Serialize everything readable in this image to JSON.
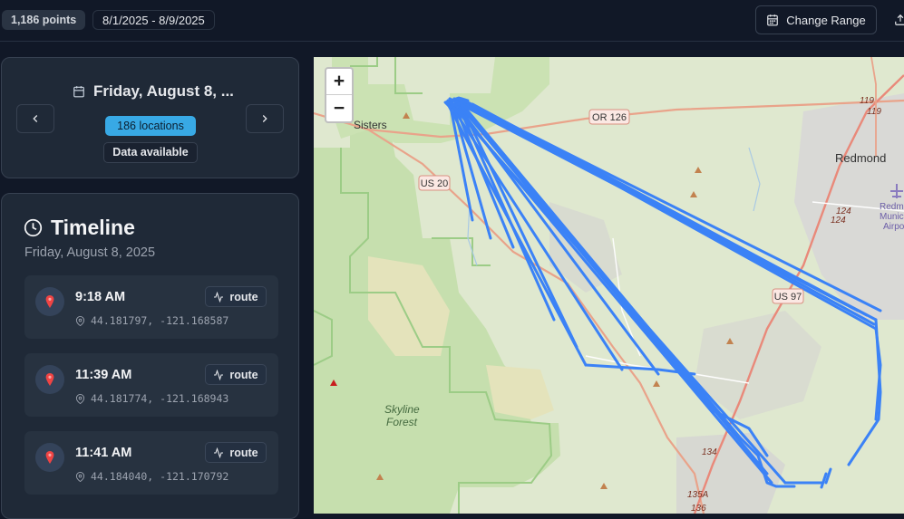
{
  "header": {
    "points_label": "1,186 points",
    "date_range": "8/1/2025 - 8/9/2025",
    "change_range_label": "Change Range"
  },
  "date_panel": {
    "date_title": "Friday, August 8, ...",
    "locations_badge": "186 locations",
    "availability_badge": "Data available"
  },
  "timeline": {
    "title": "Timeline",
    "subtitle": "Friday, August 8, 2025",
    "entries": [
      {
        "time": "9:18 AM",
        "coords": "44.181797, -121.168587",
        "route_label": "route"
      },
      {
        "time": "11:39 AM",
        "coords": "44.181774, -121.168943",
        "route_label": "route"
      },
      {
        "time": "11:41 AM",
        "coords": "44.184040, -121.170792",
        "route_label": "route"
      }
    ]
  },
  "map": {
    "zoom_in": "+",
    "zoom_out": "−",
    "labels": {
      "sisters": "Sisters",
      "redmond": "Redmond",
      "or126": "OR 126",
      "us20": "US 20",
      "us97": "US 97",
      "skyline": "Skyline",
      "forest": "Forest",
      "redmond_airport_1": "Redmo",
      "redmond_airport_2": "Munici",
      "redmond_airport_3": "Airpo",
      "r119a": "119",
      "r119b": "119",
      "r124a": "124",
      "r124b": "124",
      "r134": "134",
      "r135a": "135A",
      "r136": "136"
    },
    "route_color": "#3b82f6"
  },
  "colors": {
    "accent": "#38a9e5",
    "background": "#111827",
    "panel": "#1f2937"
  },
  "icons": [
    "calendar-icon",
    "upload-icon",
    "chevron-left-icon",
    "chevron-right-icon",
    "clock-icon",
    "map-pin-icon",
    "location-icon",
    "activity-icon"
  ]
}
